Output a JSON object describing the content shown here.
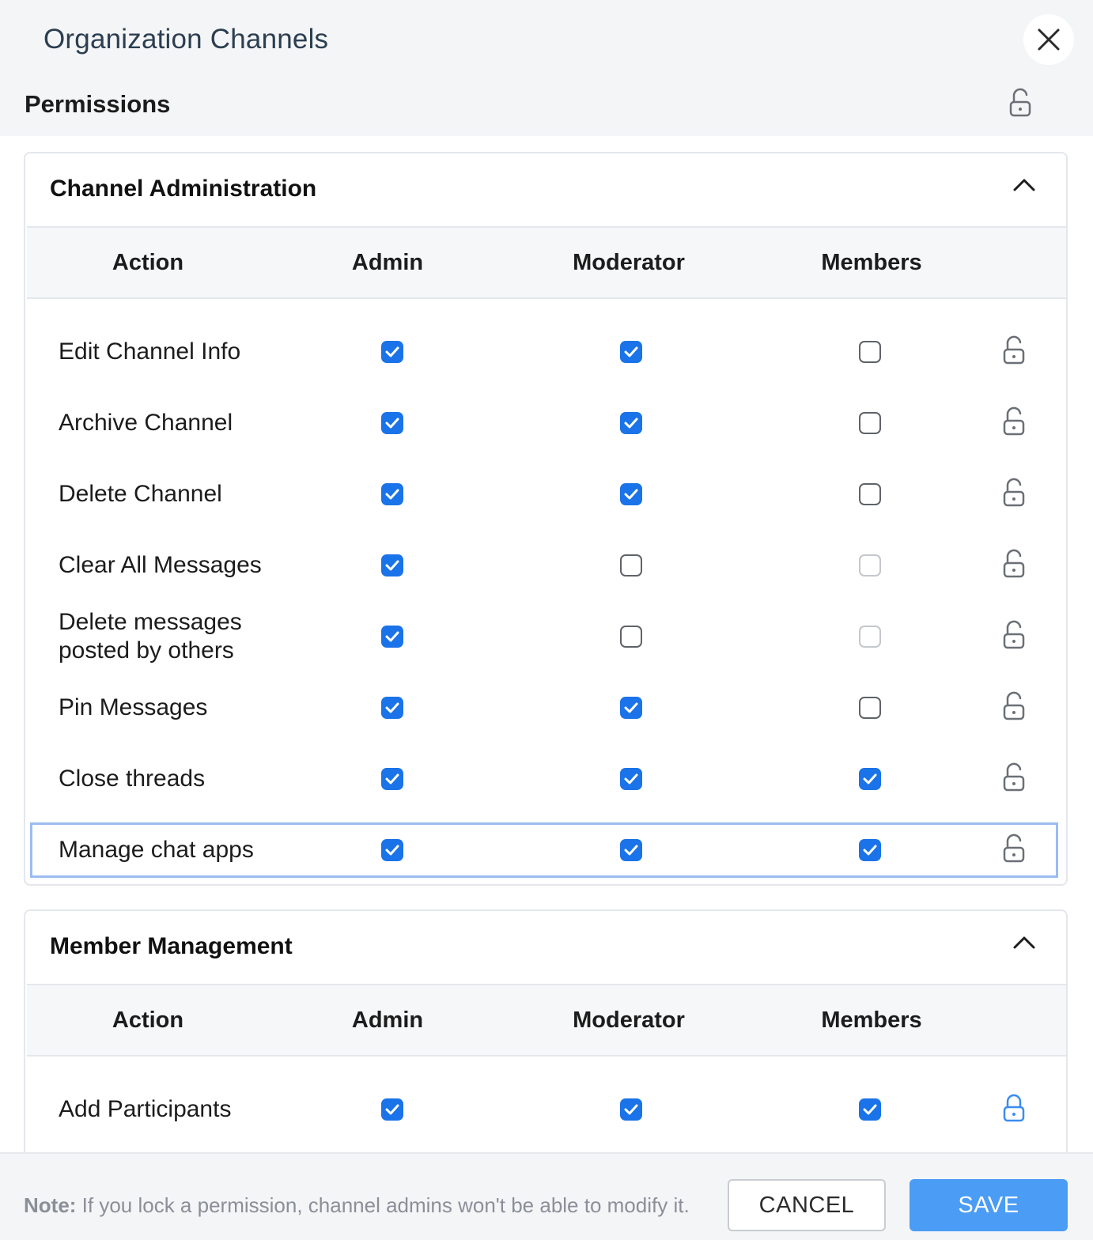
{
  "header": {
    "title": "Organization Channels",
    "close_icon": "close-icon"
  },
  "permissions": {
    "title": "Permissions",
    "lock_icon": "unlock-icon"
  },
  "columns": [
    "Action",
    "Admin",
    "Moderator",
    "Members"
  ],
  "sections": [
    {
      "title": "Channel Administration",
      "expanded": true,
      "rows": [
        {
          "label": "Edit Channel Info",
          "admin": "checked",
          "moderator": "checked",
          "members": "unchecked",
          "lock": "unlocked"
        },
        {
          "label": "Archive Channel",
          "admin": "checked",
          "moderator": "checked",
          "members": "unchecked",
          "lock": "unlocked"
        },
        {
          "label": "Delete Channel",
          "admin": "checked",
          "moderator": "checked",
          "members": "unchecked",
          "lock": "unlocked"
        },
        {
          "label": "Clear All Messages",
          "admin": "checked",
          "moderator": "unchecked",
          "members": "disabled",
          "lock": "unlocked"
        },
        {
          "label": "Delete messages posted by others",
          "admin": "checked",
          "moderator": "unchecked",
          "members": "disabled",
          "lock": "unlocked"
        },
        {
          "label": "Pin Messages",
          "admin": "checked",
          "moderator": "checked",
          "members": "unchecked",
          "lock": "unlocked"
        },
        {
          "label": "Close threads",
          "admin": "checked",
          "moderator": "checked",
          "members": "checked",
          "lock": "unlocked"
        },
        {
          "label": "Manage chat apps",
          "admin": "checked",
          "moderator": "checked",
          "members": "checked",
          "lock": "unlocked",
          "selected": true
        }
      ]
    },
    {
      "title": "Member Management",
      "expanded": true,
      "rows": [
        {
          "label": "Add Participants",
          "admin": "checked",
          "moderator": "checked",
          "members": "checked",
          "lock": "locked"
        }
      ]
    }
  ],
  "footer": {
    "note_prefix": "Note:",
    "note_text": " If you lock a permission, channel admins won't be able to modify it.",
    "cancel_label": "CANCEL",
    "save_label": "SAVE"
  },
  "colors": {
    "accent": "#1a73e8",
    "save": "#4a9cf5",
    "selected_border": "#9bbcf0"
  }
}
